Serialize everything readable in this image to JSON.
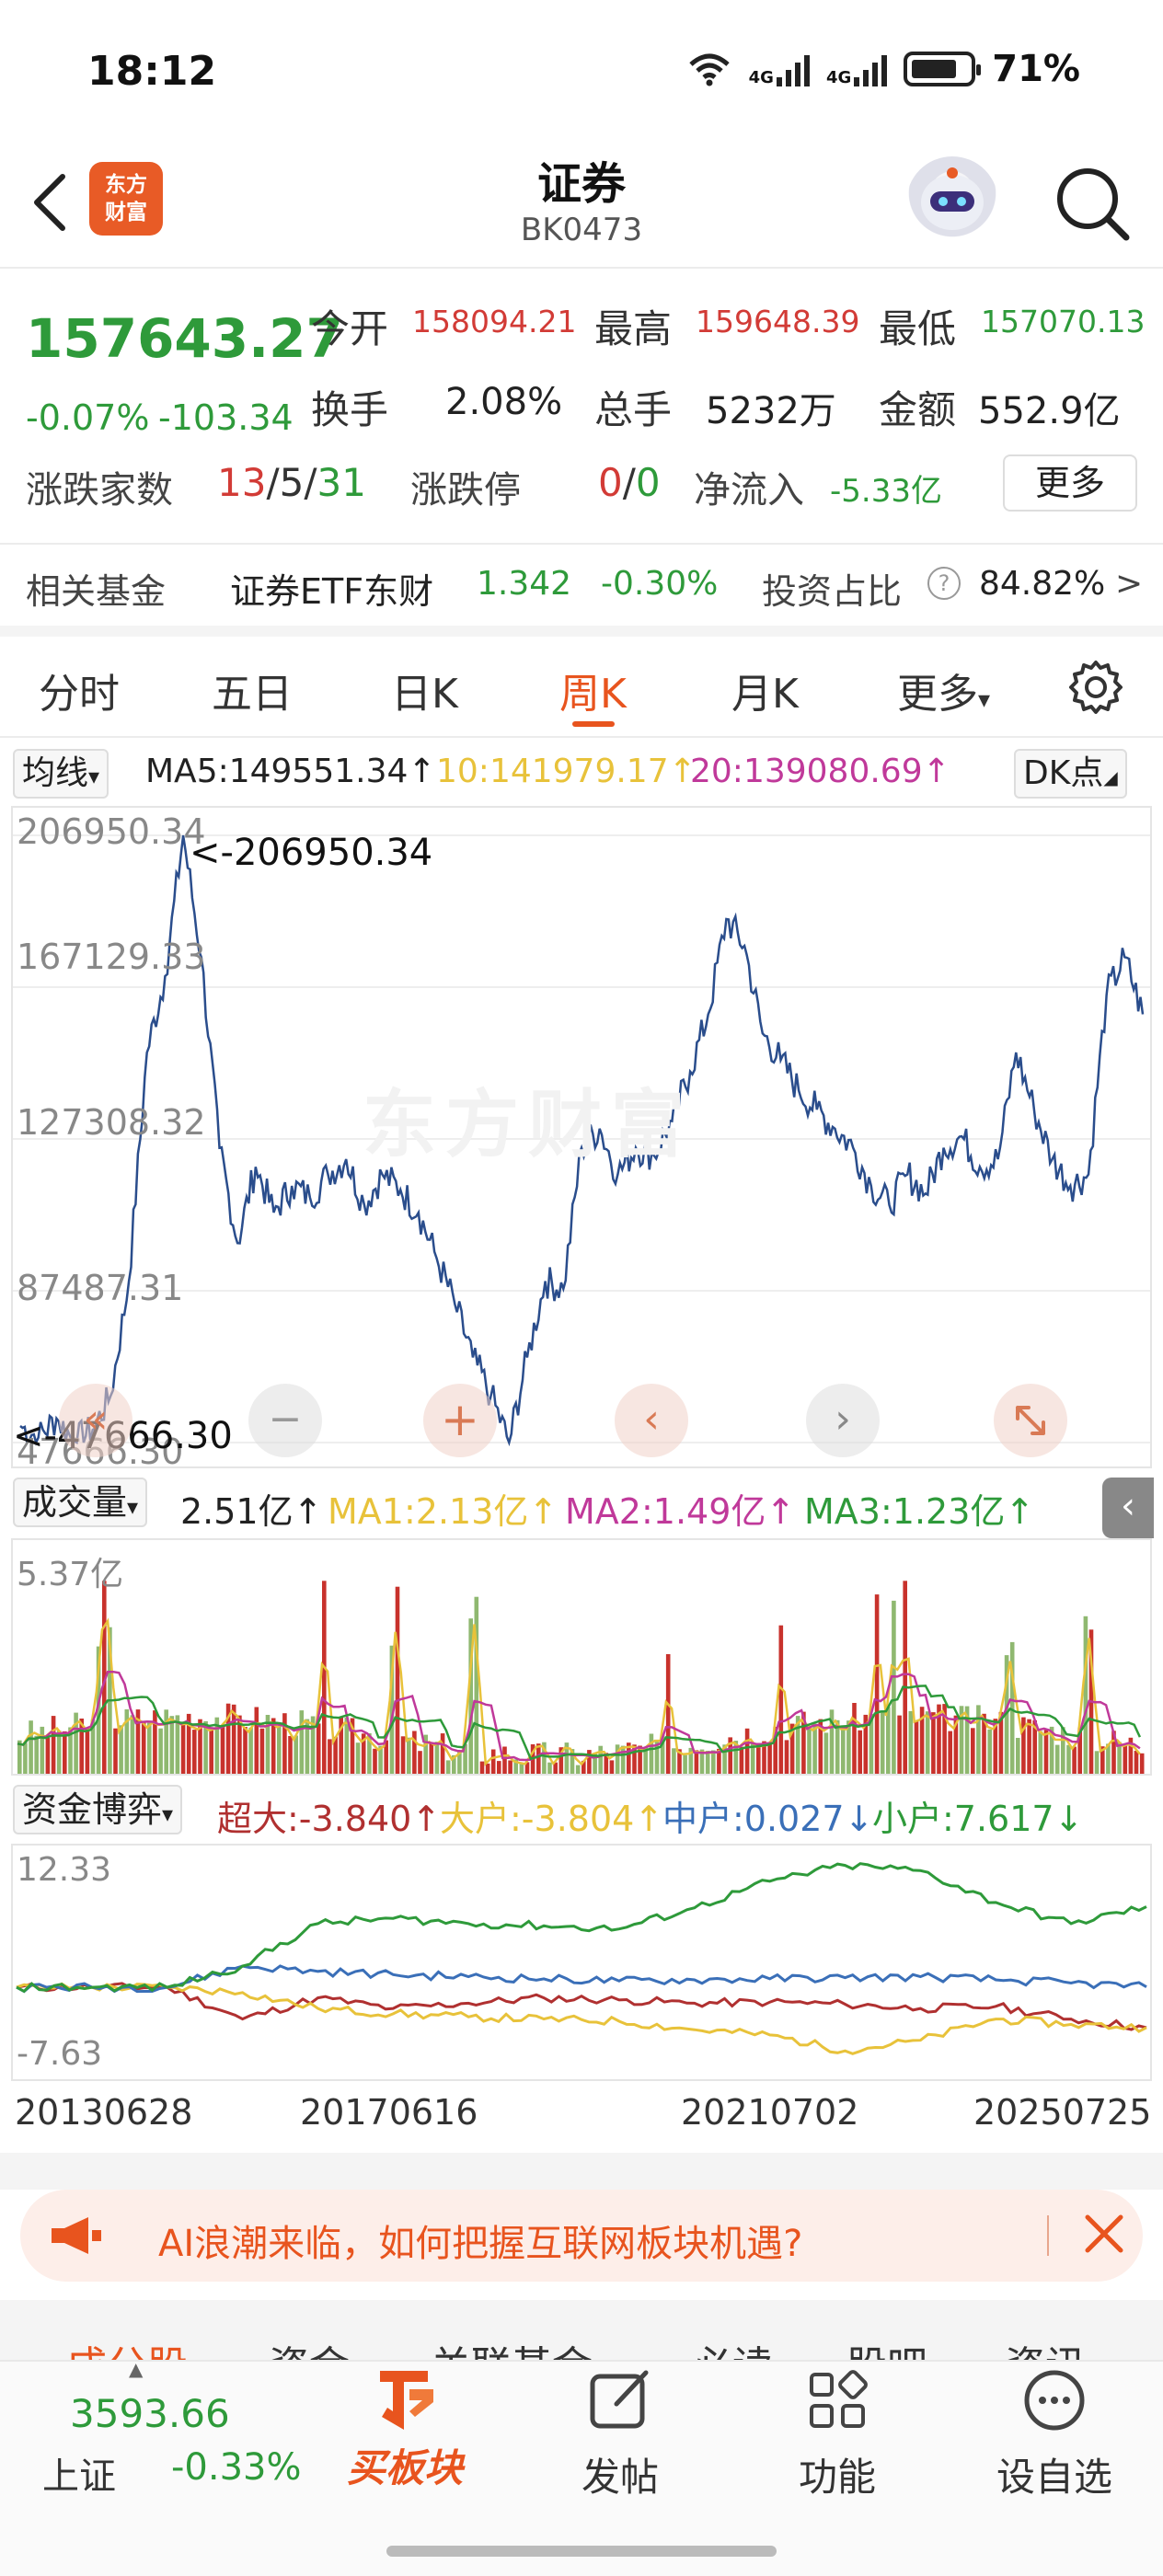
{
  "status_bar": {
    "time": "18:12",
    "battery": "71%",
    "network_1": "4G",
    "network_2": "4G",
    "icons": [
      "wifi-icon",
      "signal-icon",
      "signal-icon",
      "battery-icon"
    ]
  },
  "header": {
    "logo_line1": "东方",
    "logo_line2": "财富",
    "title": "证券",
    "code": "BK0473"
  },
  "quote": {
    "price": "157643.27",
    "change_pct": "-0.07%",
    "change": "-103.34",
    "open_label": "今开",
    "open": "158094.21",
    "high_label": "最高",
    "high": "159648.39",
    "low_label": "最低",
    "low": "157070.13",
    "turnover_label": "换手",
    "turnover": "2.08%",
    "total_hands_label": "总手",
    "total_hands": "5232万",
    "amount_label": "金额",
    "amount": "552.9亿",
    "breadth_label": "涨跌家数",
    "up": "13",
    "flat": "5",
    "down": "31",
    "limit_label": "涨跌停",
    "limit_up": "0",
    "limit_down": "0",
    "net_inflow_label": "净流入",
    "net_inflow": "-5.33亿",
    "more_button": "更多"
  },
  "fund_row": {
    "label": "相关基金",
    "fund_name": "证券ETF东财",
    "fund_price": "1.342",
    "fund_change": "-0.30%",
    "ratio_label": "投资占比",
    "ratio": "84.82%",
    "arrow": ">"
  },
  "tabs": [
    {
      "label": "分时"
    },
    {
      "label": "五日"
    },
    {
      "label": "日K"
    },
    {
      "label": "周K"
    },
    {
      "label": "月K"
    },
    {
      "label": "更多"
    }
  ],
  "ma": {
    "selector": "均线",
    "ma5": "MA5:149551.34↑",
    "ma10": "10:141979.17↑",
    "ma20": "20:139080.69↑",
    "dk_button": "DK点",
    "color_ma5": "#222222",
    "color_ma10": "#e8c23a",
    "color_ma20": "#c0399a"
  },
  "main_chart": {
    "axis_labels": [
      "206950.34",
      "167129.33",
      "127308.32",
      "87487.31",
      "47666.30"
    ],
    "max_annotation": "<-206950.34",
    "min_annotation": "<-47666.30",
    "watermark": "东方财富",
    "line_color": "#2a4d8c"
  },
  "volume": {
    "selector": "成交量",
    "value": "2.51亿↑",
    "ma1": "MA1:2.13亿↑",
    "ma2": "MA2:1.49亿↑",
    "ma3": "MA3:1.23亿↑",
    "axis_top": "5.37亿"
  },
  "fund_game": {
    "selector": "资金博弈",
    "super": "超大:-3.840↑",
    "large": "大户:-3.804↑",
    "medium": "中户:0.027↓",
    "small": "小户:7.617↓",
    "axis_top": "12.33",
    "axis_bottom": "-7.63"
  },
  "date_axis": [
    "20130628",
    "20170616",
    "20210702",
    "20250725"
  ],
  "banner": {
    "text": "AI浪潮来临，如何把握互联网板块机遇?"
  },
  "sub_tabs": [
    "成分股",
    "资金",
    "关联基金",
    "必读",
    "股吧",
    "资讯"
  ],
  "bottom_bar": {
    "index_value": "3593.66",
    "index_name": "上证",
    "index_change": "-0.33%",
    "buy_label": "买板块",
    "post_label": "发帖",
    "function_label": "功能",
    "watchlist_label": "设自选"
  },
  "chart_data": [
    {
      "type": "line",
      "title": "",
      "series": [
        {
          "values": [
            52000,
            49000,
            54000,
            48000,
            51000,
            60000,
            90000,
            150000,
            170000,
            206950,
            175000,
            125000,
            100000,
            120000,
            108000,
            115000,
            112000,
            118000,
            122000,
            110000,
            118000,
            114000,
            108000,
            96000,
            84000,
            70000,
            60000,
            47666,
            70000,
            90000,
            88000,
            125000,
            130000,
            118000,
            125000,
            123000,
            132000,
            145000,
            160000,
            185000,
            178000,
            155000,
            148000,
            140000,
            135000,
            130000,
            125000,
            115000,
            110000,
            118000,
            113000,
            125000,
            128000,
            120000,
            122000,
            150000,
            135000,
            122000,
            115000,
            118000,
            165000,
            175000,
            160000
          ]
        }
      ],
      "ylim": [
        47666.3,
        206950.34
      ]
    },
    {
      "type": "bar",
      "title": "",
      "series": [
        {
          "name": "成交量"
        },
        {
          "name": "MA1"
        },
        {
          "name": "MA2"
        },
        {
          "name": "MA3"
        }
      ],
      "ylim": [
        0,
        5.37
      ]
    },
    {
      "type": "line",
      "title": "",
      "series": [
        {
          "name": "超大",
          "values": [
            0,
            0,
            0,
            -3,
            -1,
            -2,
            -1.5,
            -1,
            -1.2,
            -1.5,
            -1.4,
            -1.6,
            -2,
            -1.8,
            -3,
            -3.8
          ]
        },
        {
          "name": "大户",
          "values": [
            0,
            0,
            0,
            -0.5,
            -2,
            -2.5,
            -2.8,
            -3,
            -3.2,
            -4,
            -4.5,
            -6,
            -5,
            -3,
            -3.5,
            -3.8
          ]
        },
        {
          "name": "中户",
          "values": [
            0,
            0,
            0,
            2,
            1.5,
            1.2,
            1,
            0.8,
            0.6,
            0.7,
            0.8,
            0.9,
            1,
            0.7,
            0.4,
            0.03
          ]
        },
        {
          "name": "小户",
          "values": [
            0,
            0,
            0,
            2,
            6,
            6.5,
            6,
            5.8,
            5.5,
            7.5,
            10,
            11.5,
            11,
            8,
            6,
            7.6
          ]
        }
      ],
      "ylim": [
        -7.63,
        12.33
      ]
    }
  ]
}
